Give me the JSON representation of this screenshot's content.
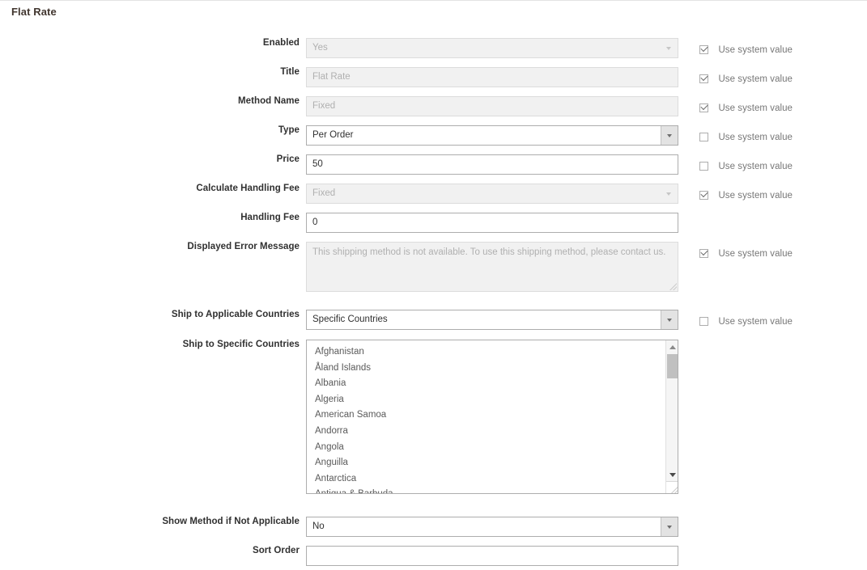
{
  "section": {
    "title": "Flat Rate"
  },
  "system_value_label": "Use system value",
  "fields": {
    "enabled": {
      "label": "Enabled",
      "value": "Yes"
    },
    "title": {
      "label": "Title",
      "value": "Flat Rate"
    },
    "method_name": {
      "label": "Method Name",
      "value": "Fixed"
    },
    "type": {
      "label": "Type",
      "value": "Per Order"
    },
    "price": {
      "label": "Price",
      "value": "50"
    },
    "calc_handling": {
      "label": "Calculate Handling Fee",
      "value": "Fixed"
    },
    "handling_fee": {
      "label": "Handling Fee",
      "value": "0"
    },
    "error_message": {
      "label": "Displayed Error Message",
      "value": "This shipping method is not available. To use this shipping method, please contact us."
    },
    "ship_applicable": {
      "label": "Ship to Applicable Countries",
      "value": "Specific Countries"
    },
    "ship_specific": {
      "label": "Ship to Specific Countries"
    },
    "show_not_applicable": {
      "label": "Show Method if Not Applicable",
      "value": "No"
    },
    "sort_order": {
      "label": "Sort Order",
      "value": ""
    }
  },
  "countries": [
    "Afghanistan",
    "Åland Islands",
    "Albania",
    "Algeria",
    "American Samoa",
    "Andorra",
    "Angola",
    "Anguilla",
    "Antarctica",
    "Antigua & Barbuda"
  ],
  "colors": {
    "text": "#303030",
    "muted": "#b0b0b0",
    "border": "#adadad",
    "disabled_bg": "#f1f1f1"
  }
}
